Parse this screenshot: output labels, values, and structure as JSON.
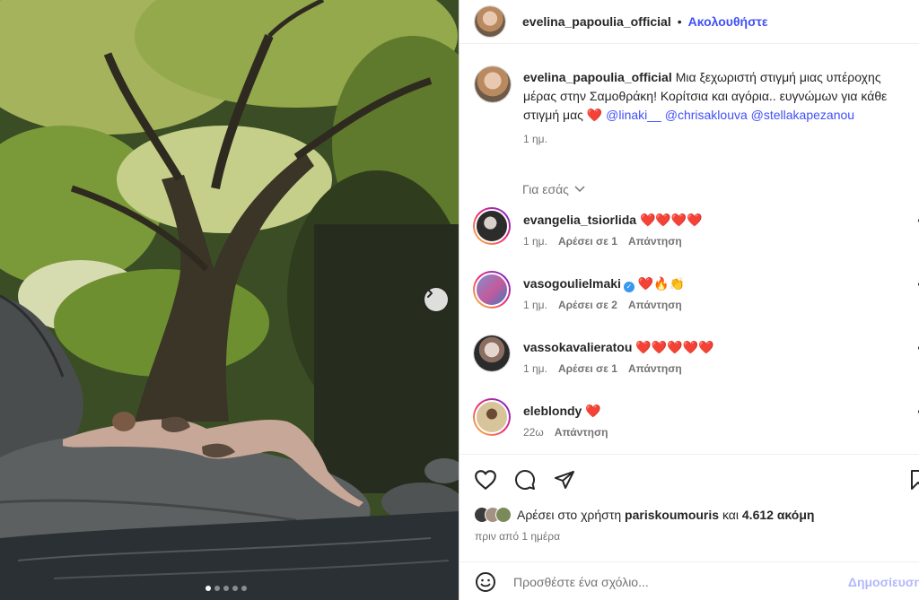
{
  "post": {
    "carousel_dots": 5,
    "active_dot": 0,
    "next_icon": "chevron-right-icon"
  },
  "header": {
    "username": "evelina_papoulia_official",
    "separator": "•",
    "follow_label": "Ακολουθήστε"
  },
  "caption": {
    "username": "evelina_papoulia_official",
    "text": "Μια ξεχωριστή στιγμή μιας υπέροχης μέρας στην Σαμοθράκη! Κορίτσια και αγόρια.. ευγνώμων για κάθε στιγμή μας ❤️ ",
    "mentions": [
      "@linaki__",
      "@chrisaklouva",
      "@stellakapezanou"
    ],
    "time": "1 ημ."
  },
  "for_you": {
    "label": "Για εσάς"
  },
  "comments": [
    {
      "username": "evangelia_tsiorlida",
      "text": "❤️❤️❤️❤️",
      "time": "1 ημ.",
      "likes": "Αρέσει σε 1",
      "reply": "Απάντηση",
      "verified": false
    },
    {
      "username": "vasogoulielmaki",
      "text": "❤️🔥👏",
      "time": "1 ημ.",
      "likes": "Αρέσει σε 2",
      "reply": "Απάντηση",
      "verified": true
    },
    {
      "username": "vassokavalieratou",
      "text": "❤️❤️❤️❤️❤️",
      "time": "1 ημ.",
      "likes": "Αρέσει σε 1",
      "reply": "Απάντηση",
      "verified": false
    },
    {
      "username": "eleblondy",
      "text": "❤️",
      "time": "22ω",
      "likes": "",
      "reply": "Απάντηση",
      "verified": false
    }
  ],
  "actions": {
    "like_icon": "heart-icon",
    "comment_icon": "comment-icon",
    "share_icon": "share-icon",
    "save_icon": "bookmark-icon"
  },
  "likes": {
    "prefix": "Αρέσει στο χρήστη",
    "user": "pariskoumouris",
    "middle": "και",
    "count": "4.612 ακόμη"
  },
  "posted_ago": "πριν από 1 ημέρα",
  "add_comment": {
    "placeholder": "Προσθέστε ένα σχόλιο...",
    "post_label": "Δημοσίευση",
    "emoji_icon": "emoji-icon"
  },
  "colors": {
    "accent": "#4150f7",
    "secondary_text": "#737373",
    "post_disabled": "#b2b8fb"
  }
}
